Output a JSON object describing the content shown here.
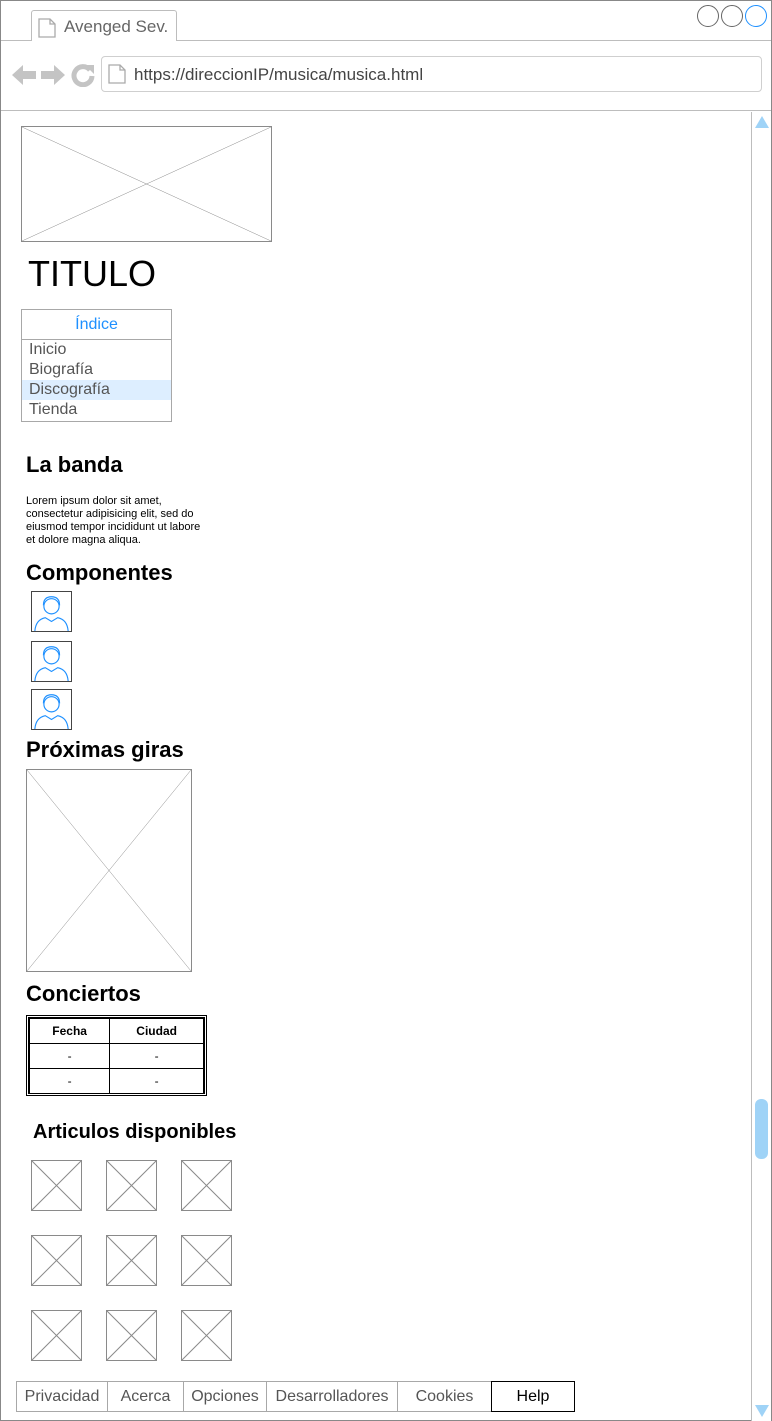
{
  "browser": {
    "tab_label": "Avenged Sev.",
    "url": "https://direccionIP/musica/musica.html"
  },
  "page": {
    "title": "TITULO",
    "index": {
      "heading": "Índice",
      "items": [
        "Inicio",
        "Biografía",
        "Discografía",
        "Tienda"
      ],
      "selected": "Discografía"
    },
    "la_banda": {
      "heading": "La banda",
      "text": "Lorem ipsum dolor sit amet, consectetur adipisicing elit, sed do eiusmod tempor incididunt ut labore et dolore magna aliqua."
    },
    "componentes": {
      "heading": "Componentes",
      "avatar_icon": "user-avatar-icon"
    },
    "giras": {
      "heading": "Próximas giras"
    },
    "conciertos": {
      "heading": "Conciertos",
      "columns": [
        "Fecha",
        "Ciudad"
      ],
      "rows": [
        [
          "-",
          "-"
        ],
        [
          "-",
          "-"
        ]
      ]
    },
    "articulos": {
      "heading": "Articulos disponibles"
    }
  },
  "footer": {
    "links": [
      "Privacidad",
      "Acerca",
      "Opciones",
      "Desarrolladores",
      "Cookies"
    ],
    "help": "Help"
  },
  "colors": {
    "accent": "#1e90ff",
    "scroll": "#9fd3f7",
    "selected_bg": "#ddeeff"
  }
}
